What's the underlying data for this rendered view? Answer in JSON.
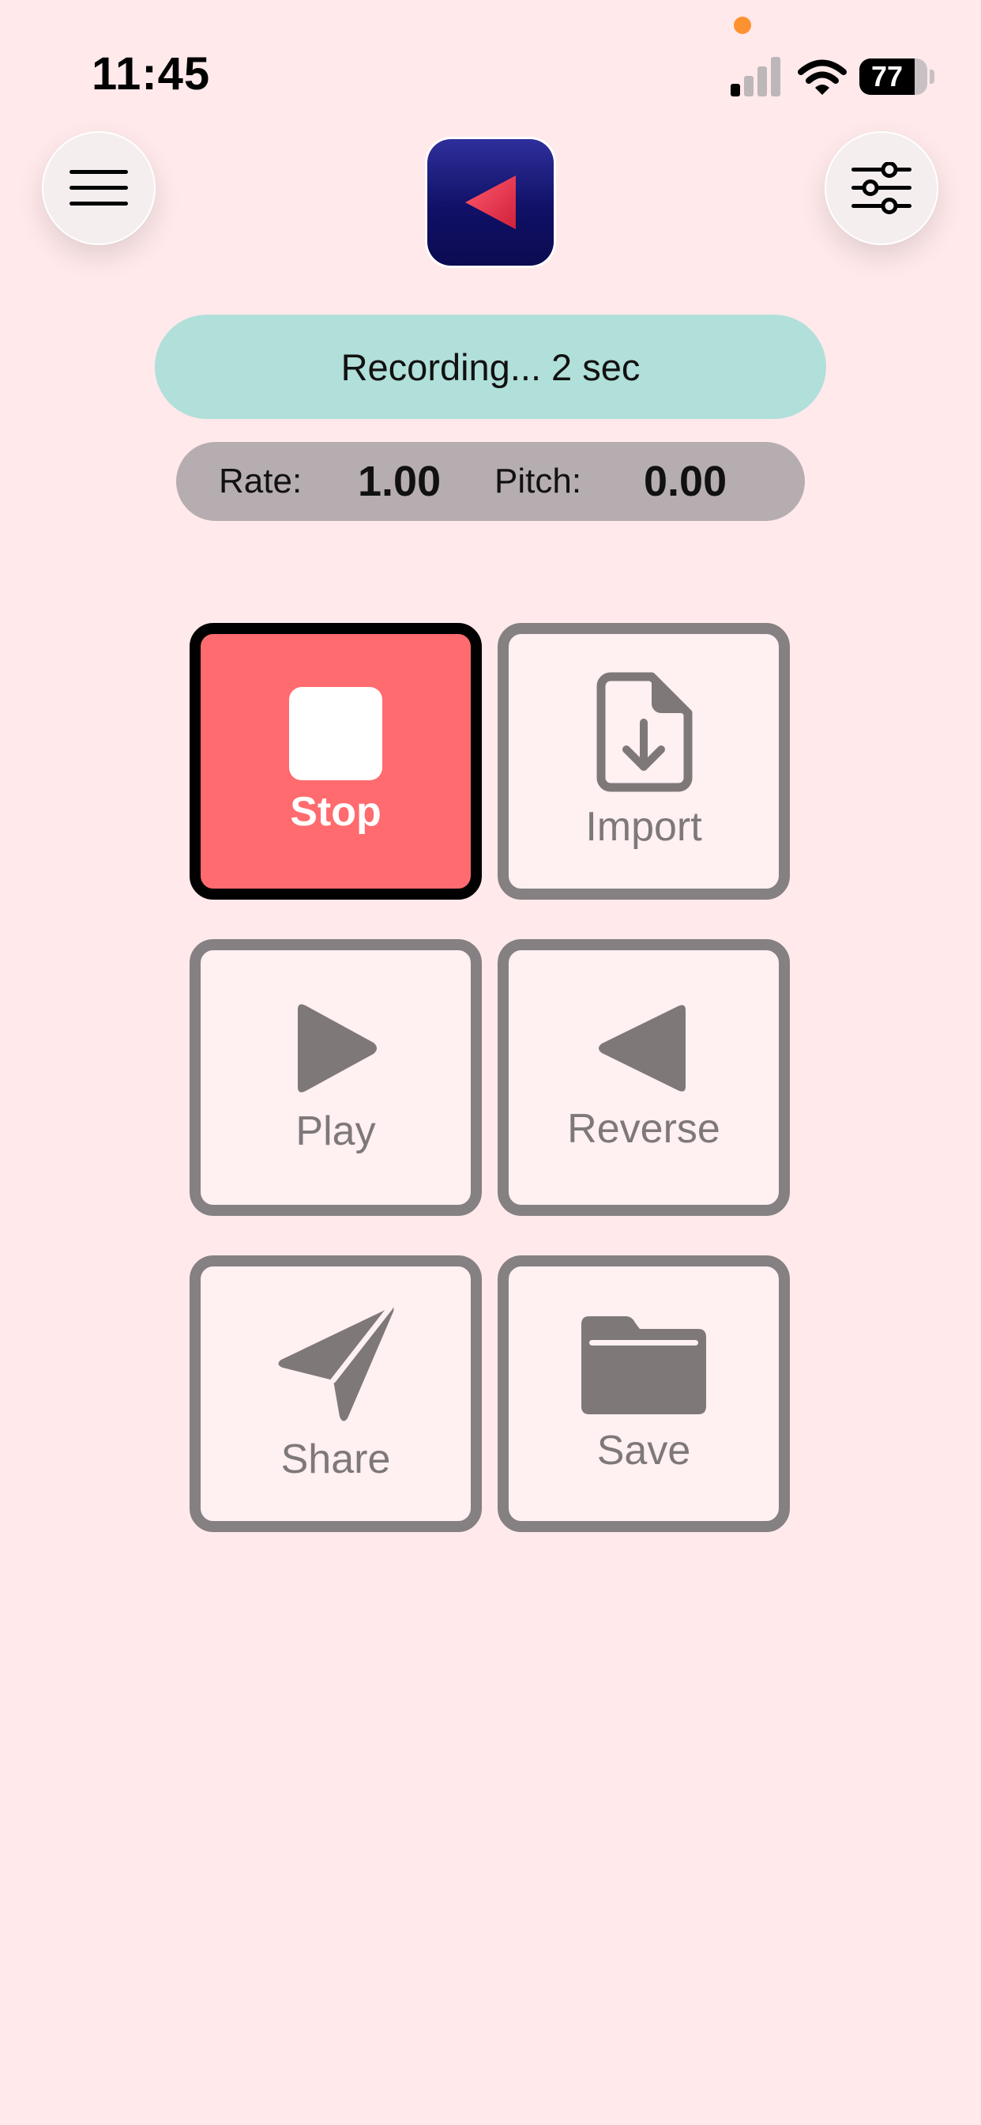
{
  "status_bar": {
    "time": "11:45",
    "battery": "77"
  },
  "header": {
    "menu_icon": "hamburger-menu-icon",
    "settings_icon": "sliders-icon",
    "app_icon": "reverse-triangle-app-icon"
  },
  "status": {
    "recording_text": "Recording... 2 sec"
  },
  "params": {
    "rate_label": "Rate:",
    "rate_value": "1.00",
    "pitch_label": "Pitch:",
    "pitch_value": "0.00"
  },
  "buttons": {
    "stop": "Stop",
    "import": "Import",
    "play": "Play",
    "reverse": "Reverse",
    "share": "Share",
    "save": "Save"
  },
  "colors": {
    "background": "#FFE9EB",
    "stop_active": "#FF6B6E",
    "recording_pill": "#B1DFD9",
    "param_pill": "#B6ADB0",
    "tile_border": "#858081"
  }
}
